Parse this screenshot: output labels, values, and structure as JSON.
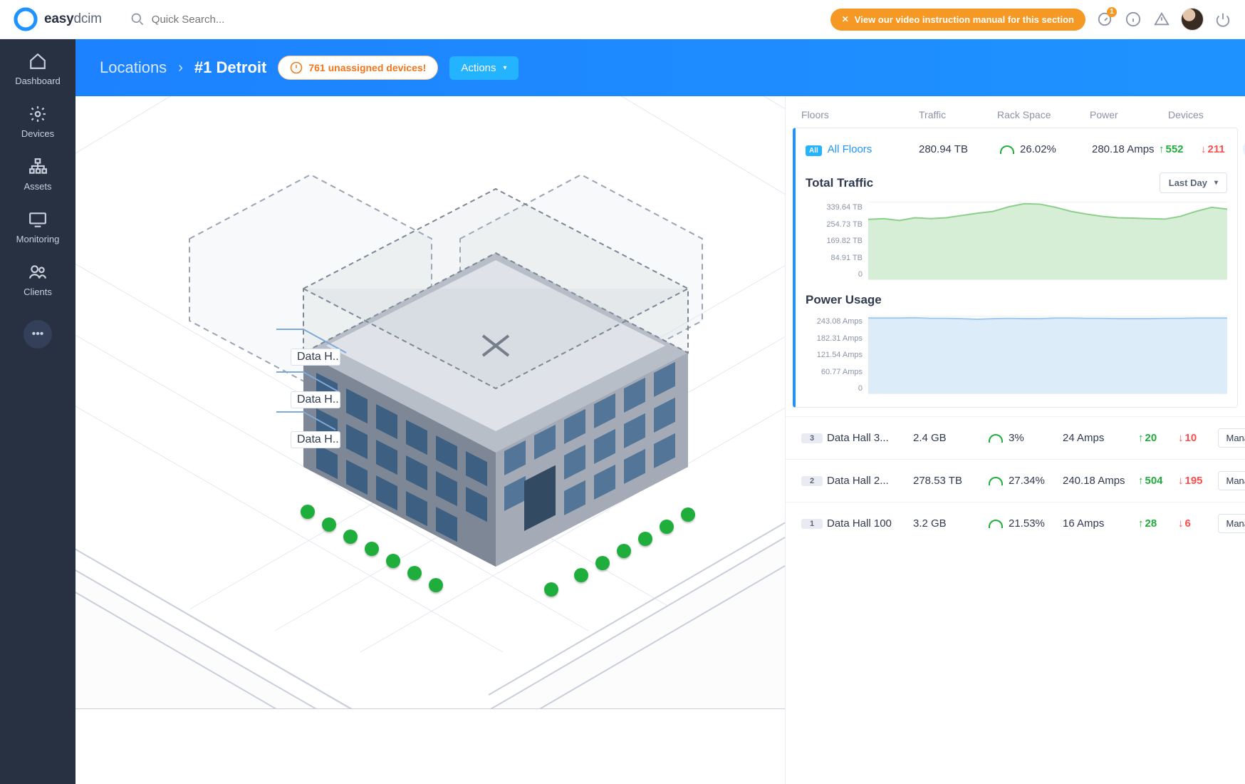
{
  "brand": {
    "name_bold": "easy",
    "name_thin": "dcim"
  },
  "search": {
    "placeholder": "Quick Search..."
  },
  "topbar": {
    "banner": "View our video instruction manual for this section",
    "notif_badge": "1"
  },
  "sidebar": {
    "items": [
      {
        "label": "Dashboard"
      },
      {
        "label": "Devices"
      },
      {
        "label": "Assets"
      },
      {
        "label": "Monitoring"
      },
      {
        "label": "Clients"
      }
    ]
  },
  "breadcrumb": {
    "root": "Locations",
    "current": "#1 Detroit",
    "warning": "761 unassigned devices!",
    "actions_label": "Actions"
  },
  "viz_labels": {
    "h1": "Data H...",
    "h2": "Data H...",
    "h3": "Data H..."
  },
  "panel": {
    "headers": {
      "floors": "Floors",
      "traffic": "Traffic",
      "rack": "Rack Space",
      "power": "Power",
      "devices": "Devices"
    },
    "all": {
      "badge": "All",
      "label": "All Floors",
      "traffic": "280.94 TB",
      "rack": "26.02%",
      "power": "280.18 Amps",
      "dev_up": "552",
      "dev_down": "211"
    },
    "traffic_chart": {
      "title": "Total Traffic",
      "range_label": "Last Day",
      "yticks": [
        "339.64 TB",
        "254.73 TB",
        "169.82 TB",
        "84.91 TB",
        "0"
      ]
    },
    "power_chart": {
      "title": "Power Usage",
      "yticks": [
        "243.08 Amps",
        "182.31 Amps",
        "121.54 Amps",
        "60.77 Amps",
        "0"
      ]
    },
    "manage_label": "Manage",
    "floors": [
      {
        "num": "3",
        "name": "Data Hall 3...",
        "traffic": "2.4 GB",
        "rack": "3%",
        "power": "24 Amps",
        "up": "20",
        "down": "10"
      },
      {
        "num": "2",
        "name": "Data Hall 2...",
        "traffic": "278.53 TB",
        "rack": "27.34%",
        "power": "240.18 Amps",
        "up": "504",
        "down": "195"
      },
      {
        "num": "1",
        "name": "Data Hall 100",
        "traffic": "3.2 GB",
        "rack": "21.53%",
        "power": "16 Amps",
        "up": "28",
        "down": "6"
      }
    ]
  },
  "chart_data": [
    {
      "type": "area",
      "title": "Total Traffic",
      "ylabel": "TB",
      "ylim": [
        0,
        339.64
      ],
      "x": [
        0,
        1,
        2,
        3,
        4,
        5,
        6,
        7,
        8,
        9,
        10,
        11,
        12,
        13,
        14,
        15,
        16,
        17,
        18,
        19,
        20,
        21,
        22,
        23
      ],
      "values": [
        265,
        268,
        260,
        272,
        268,
        272,
        282,
        292,
        300,
        320,
        334,
        332,
        318,
        300,
        288,
        278,
        272,
        270,
        268,
        266,
        278,
        300,
        318,
        310
      ],
      "color": "#8ccf8a"
    },
    {
      "type": "area",
      "title": "Power Usage",
      "ylabel": "Amps",
      "ylim": [
        0,
        243.08
      ],
      "x": [
        0,
        1,
        2,
        3,
        4,
        5,
        6,
        7,
        8,
        9,
        10,
        11,
        12,
        13,
        14,
        15,
        16,
        17,
        18,
        19,
        20,
        21,
        22,
        23
      ],
      "values": [
        238,
        238,
        238,
        239,
        237,
        237,
        236,
        234,
        236,
        237,
        236,
        236,
        238,
        238,
        237,
        237,
        236,
        236,
        236,
        237,
        237,
        238,
        238,
        238
      ],
      "color": "#9fc8ef"
    }
  ]
}
